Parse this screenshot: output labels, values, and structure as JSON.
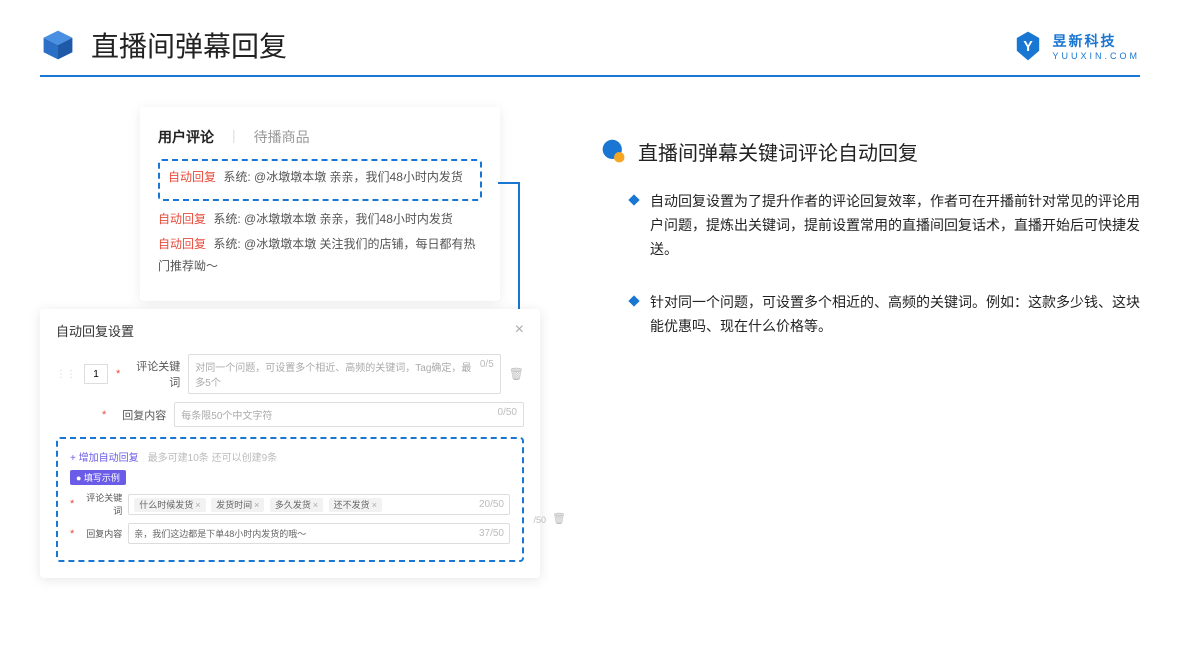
{
  "header": {
    "title": "直播间弹幕回复",
    "brand_name": "昱新科技",
    "brand_url": "YUUXIN.COM"
  },
  "card1": {
    "tab1": "用户评论",
    "tab2": "待播商品",
    "c1_badge": "自动回复",
    "c1_text": "系统: @冰墩墩本墩 亲亲，我们48小时内发货",
    "c2_badge": "自动回复",
    "c2_text": "系统: @冰墩墩本墩 亲亲，我们48小时内发货",
    "c3_badge": "自动回复",
    "c3_text": "系统: @冰墩墩本墩 关注我们的店铺，每日都有热门推荐呦～"
  },
  "card2": {
    "title": "自动回复设置",
    "idx": "1",
    "kw_label": "评论关键词",
    "kw_placeholder": "对同一个问题，可设置多个相近、高频的关键词，Tag确定，最多5个",
    "kw_counter": "0/5",
    "content_label": "回复内容",
    "content_placeholder": "每条限50个中文字符",
    "content_counter": "0/50",
    "add_link": "+ 增加自动回复",
    "add_hint": "最多可建10条 还可以创建9条",
    "example_tag": "● 填写示例",
    "ex_kw_label": "评论关键词",
    "chips": [
      "什么时候发货",
      "发货时间",
      "多久发货",
      "还不发货"
    ],
    "ex_kw_counter": "20/50",
    "ex_content_label": "回复内容",
    "ex_content_value": "亲，我们这边都是下单48小时内发货的哦～",
    "ex_content_counter": "37/50",
    "outer_counter": "/50"
  },
  "right": {
    "section_title": "直播间弹幕关键词评论自动回复",
    "bullet1": "自动回复设置为了提升作者的评论回复效率，作者可在开播前针对常见的评论用户问题，提炼出关键词，提前设置常用的直播间回复话术，直播开始后可快捷发送。",
    "bullet2": "针对同一个问题，可设置多个相近的、高频的关键词。例如：这款多少钱、这块能优惠吗、现在什么价格等。"
  }
}
